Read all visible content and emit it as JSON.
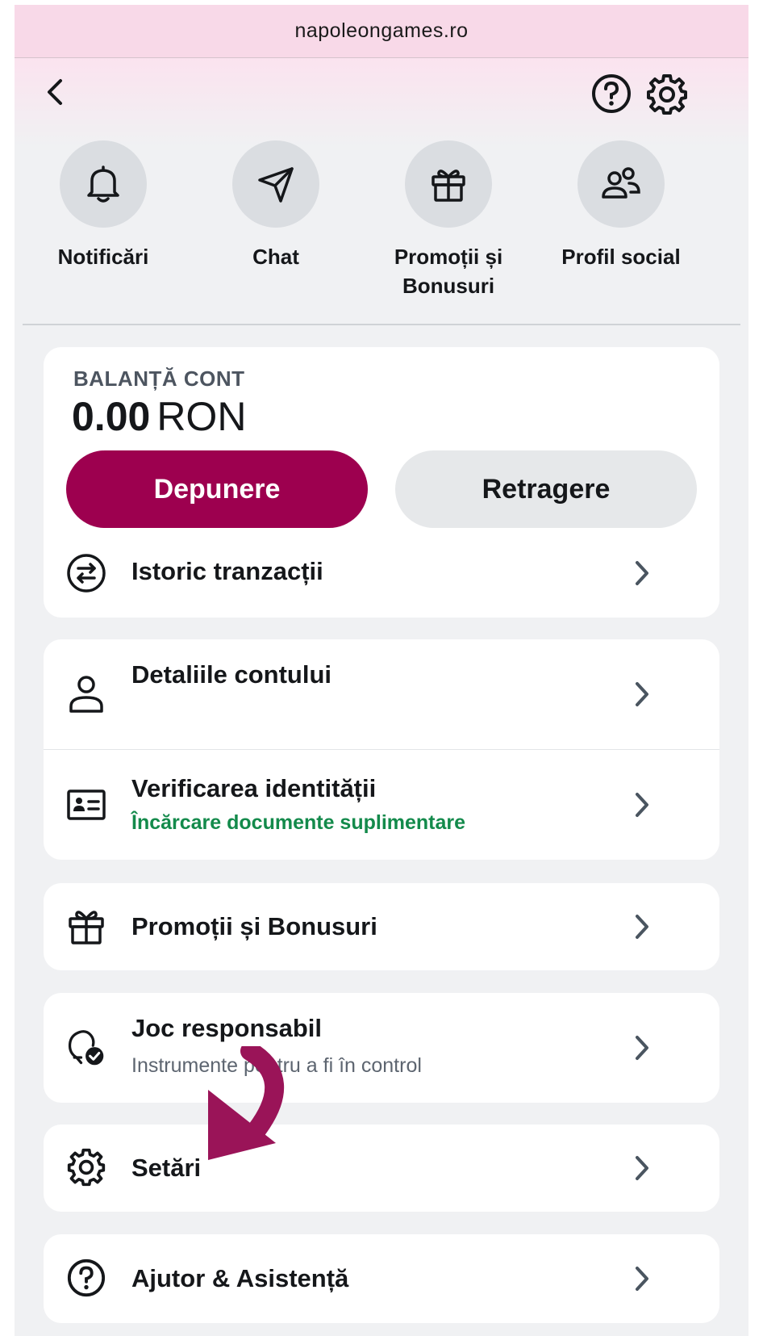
{
  "browser": {
    "url": "napoleongames.ro"
  },
  "header": {
    "back_icon": "chevron-left-icon",
    "help_icon": "question-circle-icon",
    "settings_icon": "gear-icon"
  },
  "quick_actions": [
    {
      "label": "Notificări",
      "icon": "bell-icon"
    },
    {
      "label": "Chat",
      "icon": "send-icon"
    },
    {
      "label": "Promoții și Bonusuri",
      "icon": "gift-icon"
    },
    {
      "label": "Profil social",
      "icon": "users-icon"
    }
  ],
  "balance": {
    "label": "BALANȚĂ CONT",
    "amount": "0.00",
    "currency": "RON",
    "deposit_label": "Depunere",
    "withdraw_label": "Retragere",
    "history_label": "Istoric tranzacții"
  },
  "account": {
    "details_title": "Detaliile contului",
    "verification_title": "Verificarea identității",
    "verification_subtitle": "Încărcare documente suplimentare"
  },
  "menu": {
    "promotions_title": "Promoții și Bonusuri",
    "responsible_title": "Joc responsabil",
    "responsible_subtitle": "Instrumente pentru a fi în control",
    "settings_title": "Setări",
    "help_title": "Ajutor & Asistență"
  },
  "colors": {
    "brand": "#9d004f",
    "success_text": "#138a4b",
    "annotation_arrow": "#9a1458",
    "url_bar": "#f8d9e8"
  }
}
